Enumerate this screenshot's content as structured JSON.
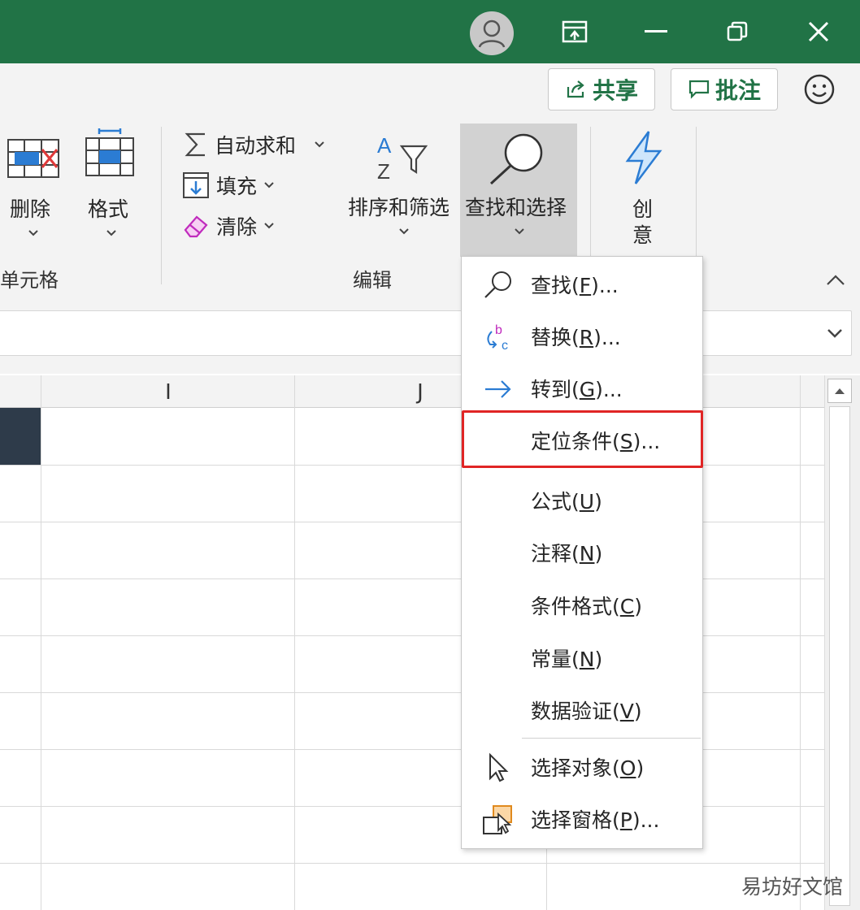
{
  "titlebar": {
    "color": "#217346",
    "buttons": [
      "account-avatar",
      "ribbon-display-options",
      "minimize",
      "restore",
      "close"
    ]
  },
  "toolbar": {
    "share_label": "共享",
    "comments_label": "批注"
  },
  "ribbon": {
    "cells_group": {
      "delete_label": "删除",
      "format_label": "格式",
      "group_label": "单元格"
    },
    "editing_group": {
      "autosum_label": "自动求和",
      "fill_label": "填充",
      "clear_label": "清除",
      "sort_filter_label": "排序和筛选",
      "find_select_label": "查找和选择",
      "group_label": "编辑"
    },
    "ideas": {
      "line1": "创",
      "line2": "意"
    }
  },
  "grid": {
    "columns": [
      "I",
      "J"
    ]
  },
  "menu": {
    "items": [
      {
        "prefix": "查找(",
        "key": "F",
        "suffix": ")...",
        "icon": "search-icon"
      },
      {
        "prefix": "替换(",
        "key": "R",
        "suffix": ")...",
        "icon": "replace-icon"
      },
      {
        "prefix": "转到(",
        "key": "G",
        "suffix": ")...",
        "icon": "arrow-right-icon"
      },
      {
        "prefix": "定位条件(",
        "key": "S",
        "suffix": ")...",
        "icon": ""
      },
      {
        "prefix": "公式(",
        "key": "U",
        "suffix": ")",
        "icon": ""
      },
      {
        "prefix": "注释(",
        "key": "N",
        "suffix": ")",
        "icon": ""
      },
      {
        "prefix": "条件格式(",
        "key": "C",
        "suffix": ")",
        "icon": ""
      },
      {
        "prefix": "常量(",
        "key": "N",
        "suffix": ")",
        "icon": ""
      },
      {
        "prefix": "数据验证(",
        "key": "V",
        "suffix": ")",
        "icon": ""
      },
      {
        "prefix": "选择对象(",
        "key": "O",
        "suffix": ")",
        "icon": "cursor-icon"
      },
      {
        "prefix": "选择窗格(",
        "key": "P",
        "suffix": ")...",
        "icon": "selection-pane-icon"
      }
    ],
    "highlighted_item": "定位条件(S)...",
    "highlight_color": "#e02525"
  },
  "watermark": "易坊好文馆"
}
